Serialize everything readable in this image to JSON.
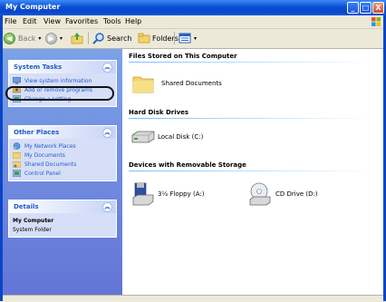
{
  "window": {
    "title": "My Computer"
  },
  "titlebar_buttons": {
    "minimize": "_",
    "maximize": "□",
    "close": "X"
  },
  "menu": [
    "File",
    "Edit",
    "View",
    "Favorites",
    "Tools",
    "Help"
  ],
  "toolbar": {
    "back_label": "Back",
    "search_label": "Search",
    "folders_label": "Folders"
  },
  "system_tasks": {
    "title": "System Tasks",
    "items": [
      "View system information",
      "Add or remove programs",
      "Change a setting"
    ]
  },
  "other_places": {
    "title": "Other Places",
    "items": [
      "My Network Places",
      "My Documents",
      "Shared Documents",
      "Control Panel"
    ]
  },
  "details": {
    "title": "Details",
    "name": "My Computer",
    "type": "System Folder"
  },
  "groups": {
    "files_stored": "Files Stored on This Computer",
    "hard_disk": "Hard Disk Drives",
    "removable": "Devices with Removable Storage"
  },
  "items": {
    "shared_documents": "Shared Documents",
    "local_disk": "Local Disk (C:)",
    "floppy": "3½ Floppy (A:)",
    "cd_drive": "CD Drive (D:)"
  },
  "colors": {
    "title_blue": "#0846c8",
    "task_link": "#215dc6",
    "left_pane": "#6f8ddf"
  }
}
